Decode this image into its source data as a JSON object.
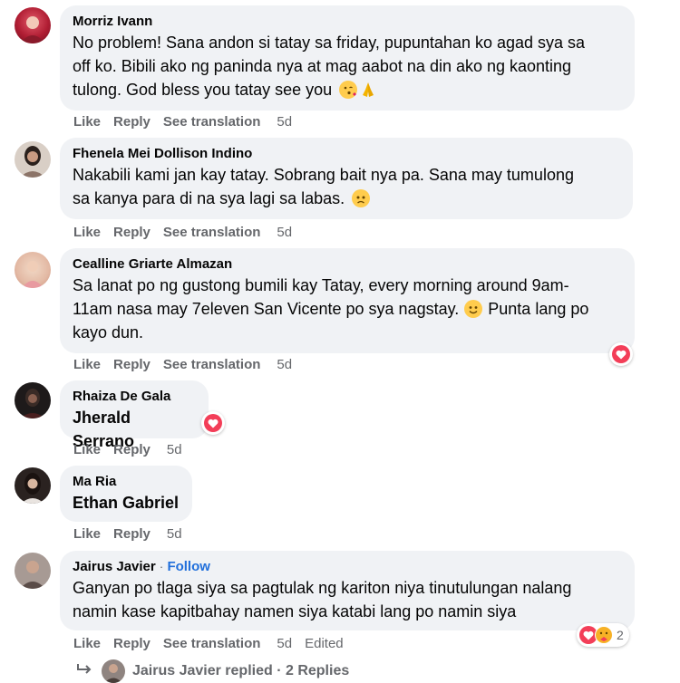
{
  "comments": [
    {
      "author": "Morriz Ivann",
      "lines": [
        "No problem! Sana andon si tatay sa friday, pupuntahan ko agad sya sa",
        "off ko. Bibili ako ng paninda nya at mag aabot na din ako ng kaonting",
        "tulong. God bless you tatay see you"
      ],
      "actions": {
        "like": "Like",
        "reply": "Reply",
        "translate": "See translation",
        "time": "5d"
      }
    },
    {
      "author": "Fhenela Mei Dollison Indino",
      "lines": [
        "Nakabili kami jan kay tatay. Sobrang bait nya pa. Sana may tumulong",
        "sa kanya para di na sya lagi sa labas."
      ],
      "actions": {
        "like": "Like",
        "reply": "Reply",
        "translate": "See translation",
        "time": "5d"
      }
    },
    {
      "author": "Cealline Griarte Almazan",
      "lines": [
        "Sa lanat po ng gustong bumili kay Tatay, every morning around 9am-",
        "11am nasa may 7eleven San Vicente po sya nagstay.",
        "kayo dun."
      ],
      "line2_suffix": "Punta lang po",
      "actions": {
        "like": "Like",
        "reply": "Reply",
        "translate": "See translation",
        "time": "5d"
      }
    },
    {
      "author": "Rhaiza De Gala",
      "tag": "Jherald Serrano",
      "actions": {
        "like": "Like",
        "reply": "Reply",
        "time": "5d"
      }
    },
    {
      "author": "Ma Ria",
      "tag": "Ethan Gabriel",
      "actions": {
        "like": "Like",
        "reply": "Reply",
        "time": "5d"
      }
    },
    {
      "author": "Jairus Javier",
      "separator": "·",
      "follow": "Follow",
      "lines": [
        "Ganyan po tlaga siya sa pagtulak ng kariton niya tinutulungan nalang",
        "namin kase kapitbahay namen siya katabi lang po namin siya"
      ],
      "reaction_count": "2",
      "actions": {
        "like": "Like",
        "reply": "Reply",
        "translate": "See translation",
        "time": "5d",
        "edited": "Edited"
      }
    }
  ],
  "replies_row": {
    "text": "Jairus Javier replied · 2 Replies"
  },
  "colors": {
    "bubble": "#f0f2f5",
    "meta_text": "#65676b",
    "link_blue": "#216fdb",
    "love_red": "#f33e58"
  },
  "icons": [
    "kissing-face-icon",
    "folded-hands-icon",
    "frowning-face-icon",
    "smiling-face-icon",
    "love-heart-icon",
    "care-face-icon",
    "reply-arrow-icon"
  ]
}
